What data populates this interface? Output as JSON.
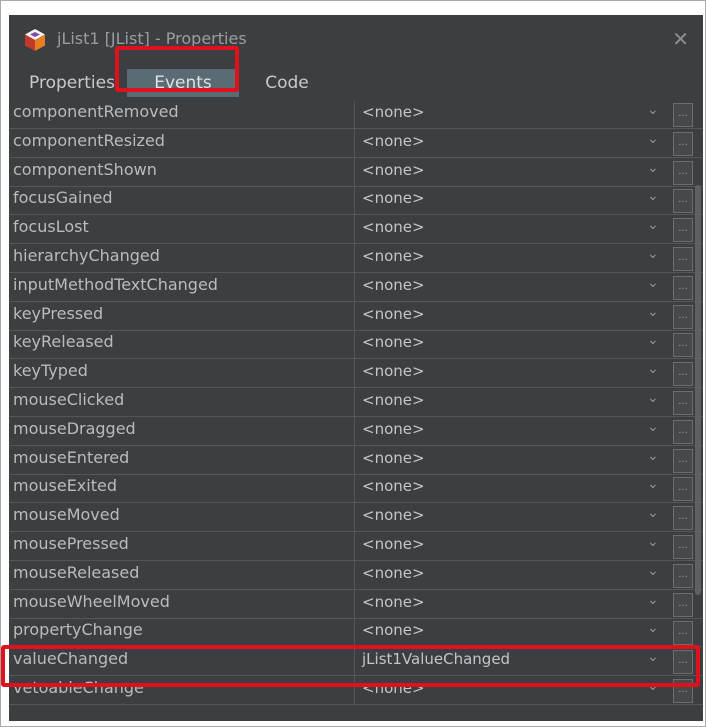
{
  "window": {
    "title": "jList1 [JList] - Properties",
    "close_glyph": "✕",
    "app_icon": "netbeans-cube-icon"
  },
  "tabs": [
    {
      "label": "Properties"
    },
    {
      "label": "Events"
    },
    {
      "label": "Code"
    }
  ],
  "events": [
    {
      "name": "componentRemoved",
      "handler": "<none>"
    },
    {
      "name": "componentResized",
      "handler": "<none>"
    },
    {
      "name": "componentShown",
      "handler": "<none>"
    },
    {
      "name": "focusGained",
      "handler": "<none>"
    },
    {
      "name": "focusLost",
      "handler": "<none>"
    },
    {
      "name": "hierarchyChanged",
      "handler": "<none>"
    },
    {
      "name": "inputMethodTextChanged",
      "handler": "<none>"
    },
    {
      "name": "keyPressed",
      "handler": "<none>"
    },
    {
      "name": "keyReleased",
      "handler": "<none>"
    },
    {
      "name": "keyTyped",
      "handler": "<none>"
    },
    {
      "name": "mouseClicked",
      "handler": "<none>"
    },
    {
      "name": "mouseDragged",
      "handler": "<none>"
    },
    {
      "name": "mouseEntered",
      "handler": "<none>"
    },
    {
      "name": "mouseExited",
      "handler": "<none>"
    },
    {
      "name": "mouseMoved",
      "handler": "<none>"
    },
    {
      "name": "mousePressed",
      "handler": "<none>"
    },
    {
      "name": "mouseReleased",
      "handler": "<none>"
    },
    {
      "name": "mouseWheelMoved",
      "handler": "<none>"
    },
    {
      "name": "propertyChange",
      "handler": "<none>"
    },
    {
      "name": "valueChanged",
      "handler": "jList1ValueChanged"
    },
    {
      "name": "vetoableChange",
      "handler": "<none>"
    }
  ],
  "ellipsis_label": "...",
  "colors": {
    "background": "#3c3f41",
    "highlight": "#e0111b",
    "selected_tab": "#5a6b73"
  }
}
